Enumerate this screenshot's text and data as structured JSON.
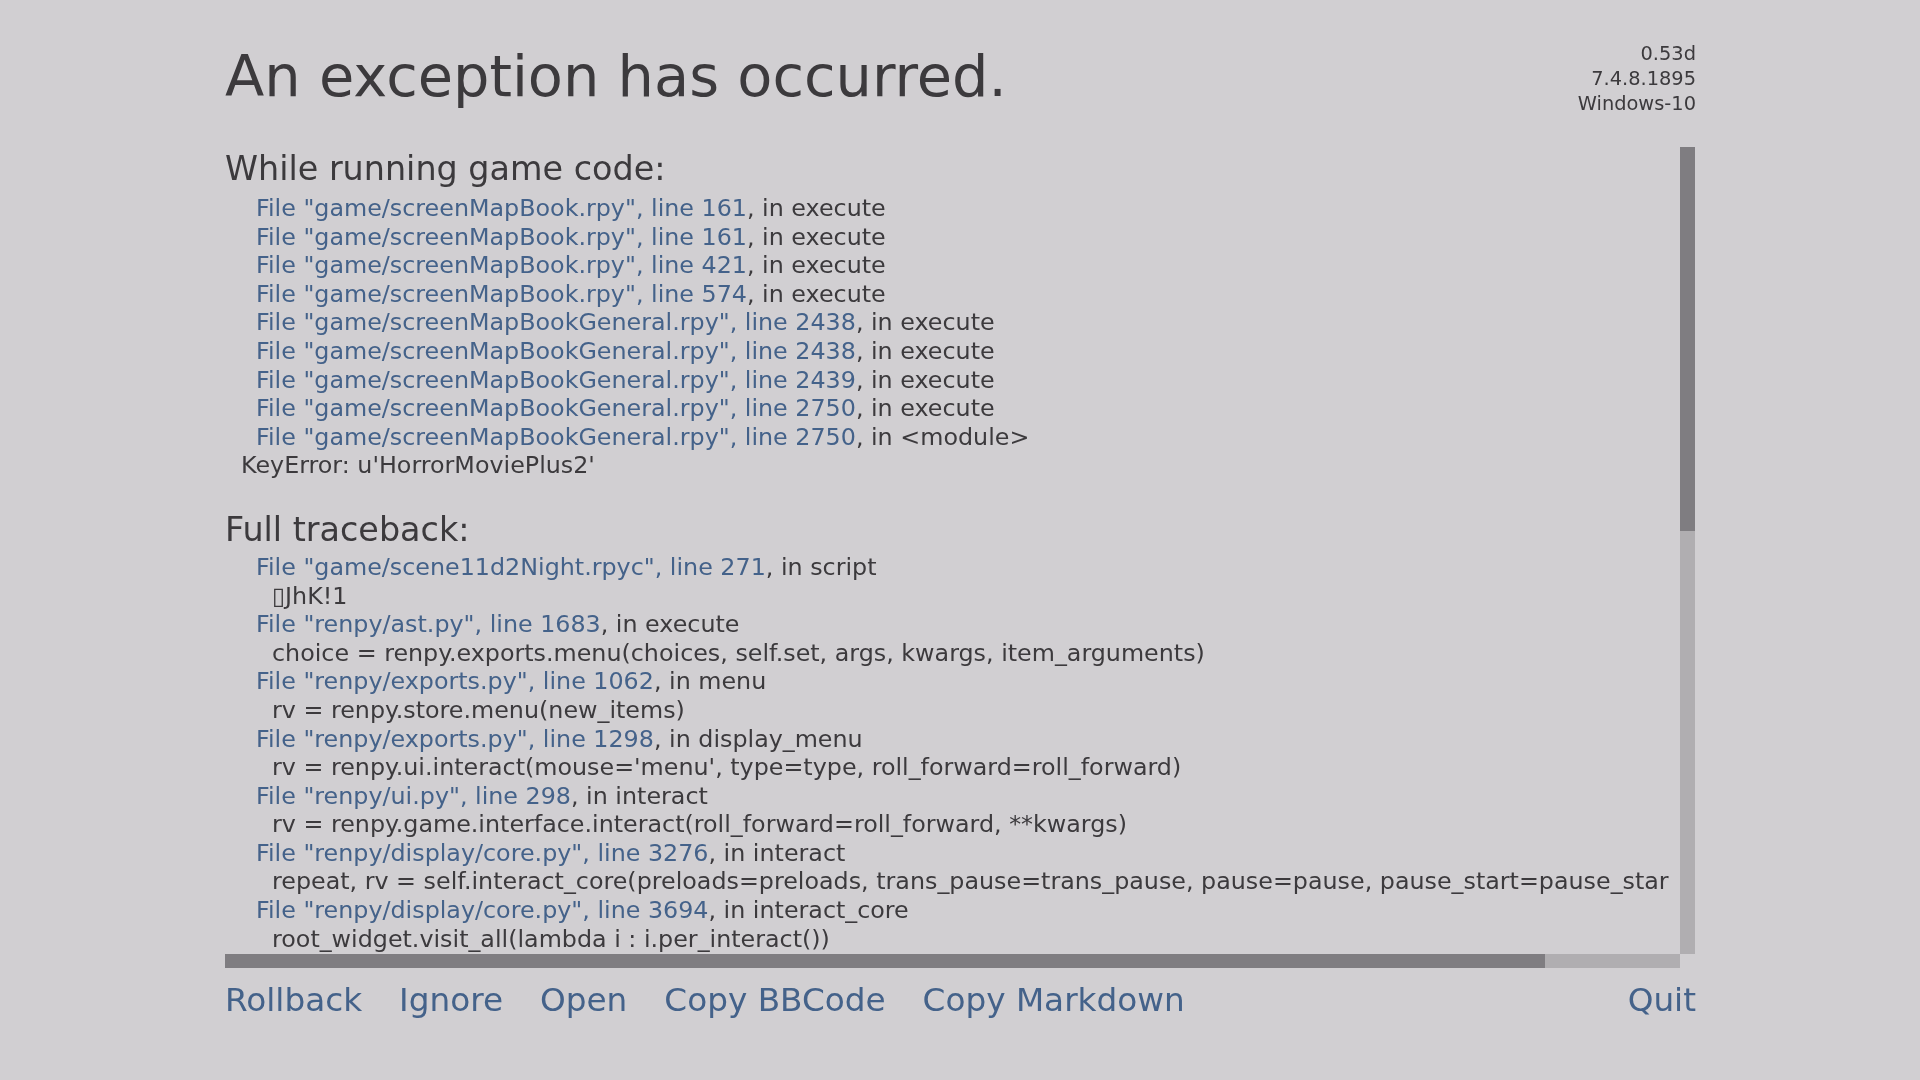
{
  "title": "An exception has occurred.",
  "version_info": [
    "0.53d",
    "7.4.8.1895",
    "Windows-10"
  ],
  "sections": [
    {
      "heading": "While running game code:",
      "lines": [
        {
          "kind": "frame",
          "location": "File \"game/screenMapBook.rpy\", line 161",
          "text": ", in execute"
        },
        {
          "kind": "frame",
          "location": "File \"game/screenMapBook.rpy\", line 161",
          "text": ", in execute"
        },
        {
          "kind": "frame",
          "location": "File \"game/screenMapBook.rpy\", line 421",
          "text": ", in execute"
        },
        {
          "kind": "frame",
          "location": "File \"game/screenMapBook.rpy\", line 574",
          "text": ", in execute"
        },
        {
          "kind": "frame",
          "location": "File \"game/screenMapBookGeneral.rpy\", line 2438",
          "text": ", in execute"
        },
        {
          "kind": "frame",
          "location": "File \"game/screenMapBookGeneral.rpy\", line 2438",
          "text": ", in execute"
        },
        {
          "kind": "frame",
          "location": "File \"game/screenMapBookGeneral.rpy\", line 2439",
          "text": ", in execute"
        },
        {
          "kind": "frame",
          "location": "File \"game/screenMapBookGeneral.rpy\", line 2750",
          "text": ", in execute"
        },
        {
          "kind": "frame",
          "location": "File \"game/screenMapBookGeneral.rpy\", line 2750",
          "text": ", in <module>"
        },
        {
          "kind": "error",
          "text": "KeyError: u'HorrorMoviePlus2'"
        }
      ]
    },
    {
      "heading": "Full traceback:",
      "lines": [
        {
          "kind": "frame",
          "location": "File \"game/scene11d2Night.rpyc\", line 271",
          "text": ", in script"
        },
        {
          "kind": "code",
          "text": "▯JhK!1"
        },
        {
          "kind": "frame",
          "location": "File \"renpy/ast.py\", line 1683",
          "text": ", in execute"
        },
        {
          "kind": "code",
          "text": "choice = renpy.exports.menu(choices, self.set, args, kwargs, item_arguments)"
        },
        {
          "kind": "frame",
          "location": "File \"renpy/exports.py\", line 1062",
          "text": ", in menu"
        },
        {
          "kind": "code",
          "text": "rv = renpy.store.menu(new_items)"
        },
        {
          "kind": "frame",
          "location": "File \"renpy/exports.py\", line 1298",
          "text": ", in display_menu"
        },
        {
          "kind": "code",
          "text": "rv = renpy.ui.interact(mouse='menu', type=type, roll_forward=roll_forward)"
        },
        {
          "kind": "frame",
          "location": "File \"renpy/ui.py\", line 298",
          "text": ", in interact"
        },
        {
          "kind": "code",
          "text": "rv = renpy.game.interface.interact(roll_forward=roll_forward, **kwargs)"
        },
        {
          "kind": "frame",
          "location": "File \"renpy/display/core.py\", line 3276",
          "text": ", in interact"
        },
        {
          "kind": "code",
          "text": "repeat, rv = self.interact_core(preloads=preloads, trans_pause=trans_pause, pause=pause, pause_start=pause_star"
        },
        {
          "kind": "frame",
          "location": "File \"renpy/display/core.py\", line 3694",
          "text": ", in interact_core"
        },
        {
          "kind": "code",
          "text": "root_widget.visit_all(lambda i : i.per_interact())"
        }
      ]
    }
  ],
  "buttons_left": [
    "Rollback",
    "Ignore",
    "Open",
    "Copy BBCode",
    "Copy Markdown"
  ],
  "buttons_right": [
    "Quit"
  ]
}
